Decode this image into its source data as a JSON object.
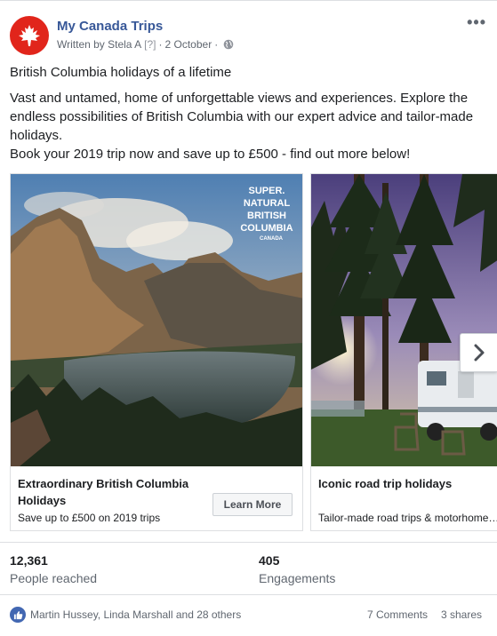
{
  "post": {
    "page_name": "My Canada Trips",
    "written_by": "Written by Stela A",
    "info_marker": "[?]",
    "separator": "·",
    "date": "2 October",
    "separator2": "·",
    "more_icon": "more-options-icon",
    "headline": "British Columbia holidays of a lifetime",
    "body_line1": "Vast and untamed, home of unforgettable views and experiences. Explore the endless possibilities of British Columbia with our expert advice and tailor-made holidays.",
    "body_line2": "Book your 2019 trip now and save up to £500 - find out more below!"
  },
  "carousel": {
    "cards": [
      {
        "title": "Extraordinary British Columbia Holidays",
        "subtitle": "Save up to £500 on 2019 trips",
        "cta": "Learn More",
        "logo_text": "SUPER. NATURAL BRITISH COLUMBIA CANADA"
      },
      {
        "title": "Iconic road trip holidays",
        "subtitle": "Tailor-made road trips & motorhome holidays"
      }
    ]
  },
  "stats": {
    "reached_value": "12,361",
    "reached_label": "People reached",
    "engagements_value": "405",
    "engagements_label": "Engagements"
  },
  "reactions": {
    "names": "Martin Hussey, Linda Marshall and 28 others",
    "comments": "7 Comments",
    "shares": "3 shares"
  },
  "colors": {
    "brand_red": "#e1251b",
    "link_blue": "#385898",
    "like_blue": "#4267b2"
  }
}
